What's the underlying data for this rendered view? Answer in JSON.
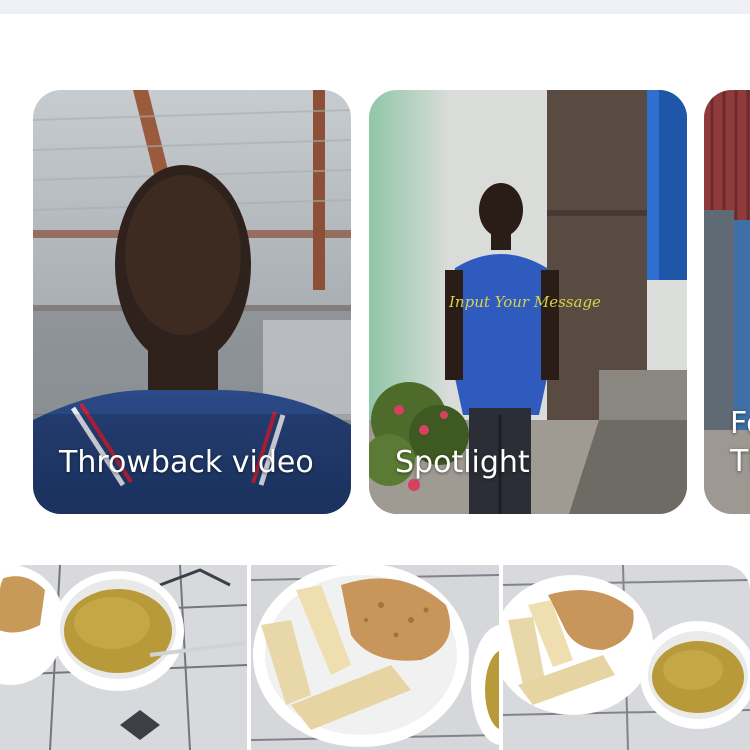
{
  "memories": {
    "cards": [
      {
        "label": "Throwback video"
      },
      {
        "label": "Spotlight",
        "overlay_text": "Input Your Message"
      },
      {
        "label": "Fo\nTh"
      }
    ]
  },
  "photo_grid": {
    "tiles": [
      {
        "subject": "food-photo"
      },
      {
        "subject": "food-photo"
      },
      {
        "subject": "food-photo"
      }
    ]
  },
  "colors": {
    "card_text": "#ffffff",
    "overlay_text": "#d7d04a",
    "top_bar": "#eef0f6"
  }
}
